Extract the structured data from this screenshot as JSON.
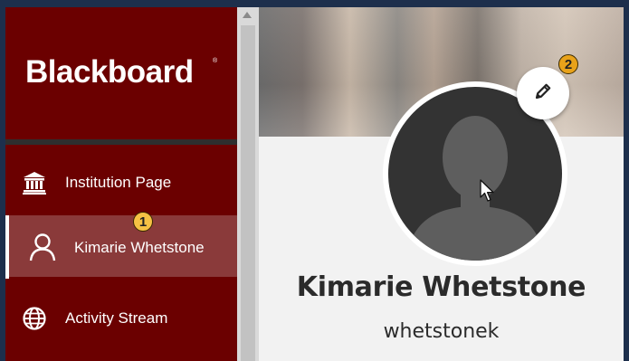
{
  "brand": {
    "name": "Blackboard",
    "trademark": "®"
  },
  "sidebar": {
    "items": [
      {
        "label": "Institution Page",
        "icon": "institution-icon",
        "active": false
      },
      {
        "label": "Kimarie Whetstone",
        "icon": "user-icon",
        "active": true
      },
      {
        "label": "Activity Stream",
        "icon": "globe-icon",
        "active": false
      }
    ]
  },
  "profile": {
    "display_name": "Kimarie Whetstone",
    "username": "whetstonek",
    "edit_icon": "pencil-icon"
  },
  "callouts": {
    "first": "1",
    "second": "2"
  },
  "colors": {
    "sidebar_bg": "#6b0000",
    "active_item_bg": "#8a3a3a",
    "callout": "#f5a623",
    "avatar_bg": "#333333"
  }
}
